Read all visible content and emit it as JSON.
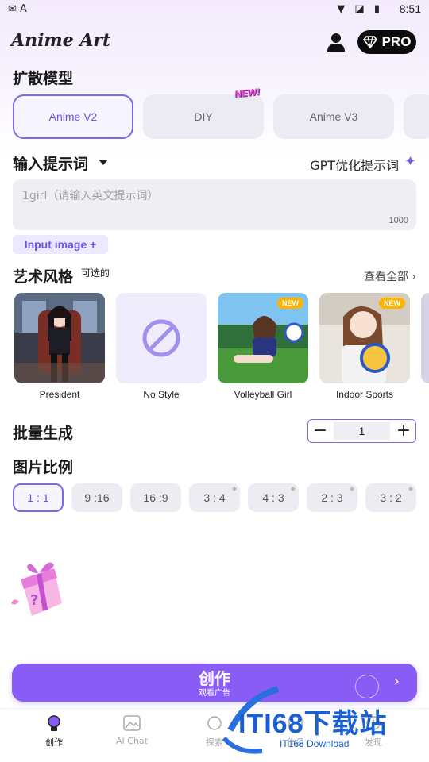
{
  "status_bar": {
    "time": "8:51",
    "left_icons": [
      "wechat-icon",
      "app-icon"
    ],
    "right_icons": [
      "wifi-icon",
      "no-sim-icon",
      "battery-icon"
    ],
    "left_glyphs": "✉ A",
    "right_glyphs": "▼ ◪ ▮"
  },
  "header": {
    "app_title": "Anime Art",
    "pro_label": "PRO"
  },
  "model_section": {
    "title": "扩散模型",
    "new_badge": "NEW!",
    "models": [
      {
        "label": "Anime V2",
        "selected": true
      },
      {
        "label": "DIY",
        "selected": false
      },
      {
        "label": "Anime V3",
        "selected": false
      }
    ]
  },
  "prompt_section": {
    "title": "输入提示词",
    "gpt_link": "GPT优化提示词",
    "placeholder": "1girl（请输入英文提示词）",
    "char_limit": "1000",
    "input_image": "Input image +"
  },
  "style_section": {
    "title": "艺术风格",
    "optional": "可选的",
    "view_all": "查看全部",
    "styles": [
      {
        "label": "President",
        "new": false
      },
      {
        "label": "No Style",
        "new": false
      },
      {
        "label": "Volleyball Girl",
        "new": true
      },
      {
        "label": "Indoor Sports",
        "new": true
      }
    ],
    "new_label": "NEW"
  },
  "batch_section": {
    "title": "批量生成",
    "value": "1",
    "minus": "−",
    "plus": "+"
  },
  "ratio_section": {
    "title": "图片比例",
    "ratios": [
      {
        "label": "1 : 1",
        "selected": true,
        "premium": false
      },
      {
        "label": "9 :16",
        "selected": false,
        "premium": false
      },
      {
        "label": "16 :9",
        "selected": false,
        "premium": false
      },
      {
        "label": "3 : 4",
        "selected": false,
        "premium": true
      },
      {
        "label": "4 : 3",
        "selected": false,
        "premium": true
      },
      {
        "label": "2 : 3",
        "selected": false,
        "premium": true
      },
      {
        "label": "3 : 2",
        "selected": false,
        "premium": true
      }
    ]
  },
  "create_button": {
    "title": "创作",
    "subtitle": "观看广告"
  },
  "bottom_nav": [
    {
      "label": "创作",
      "icon": "bulb-icon",
      "active": true
    },
    {
      "label": "AI Chat",
      "icon": "image-icon",
      "active": false
    },
    {
      "label": "探索",
      "icon": "explore-icon",
      "active": false
    },
    {
      "label": "作品",
      "icon": "works-icon",
      "active": false
    },
    {
      "label": "发现",
      "icon": "discover-icon",
      "active": false
    }
  ],
  "watermark": {
    "text": "ITI68下载站",
    "sub": "IT168 Download"
  },
  "colors": {
    "accent": "#7b68ee",
    "button": "#8a5cf6",
    "chip_bg": "#ececf2"
  }
}
